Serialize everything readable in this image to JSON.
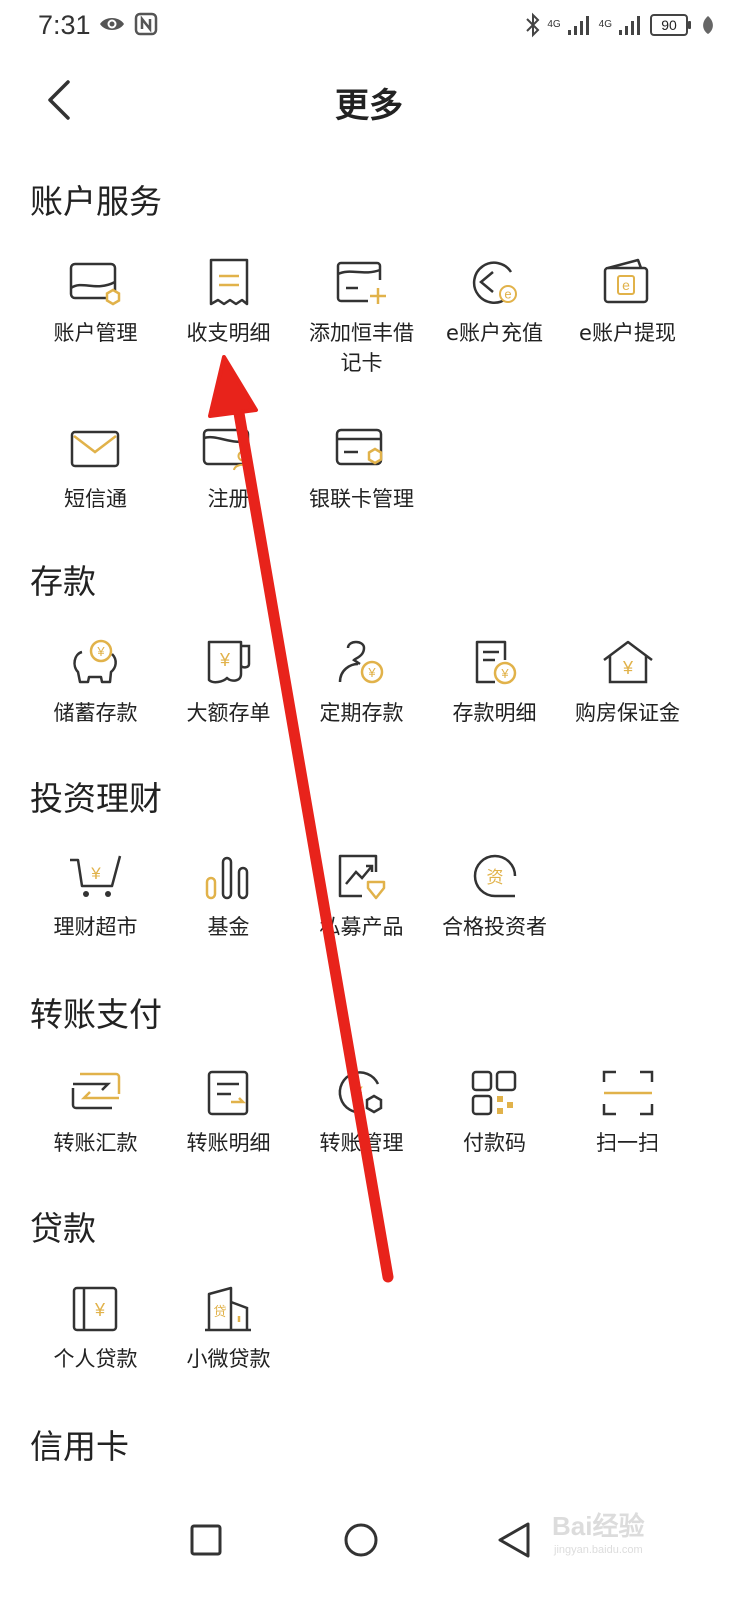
{
  "status_bar": {
    "time": "7:31",
    "network_1": "4G",
    "network_2": "4G",
    "battery": "90"
  },
  "header": {
    "title": "更多"
  },
  "sections": [
    {
      "title": "账户服务",
      "items": [
        {
          "label": "账户管理",
          "icon": "card-shield-icon"
        },
        {
          "label": "收支明细",
          "icon": "receipt-icon"
        },
        {
          "label": "添加恒丰借记卡",
          "icon": "add-card-icon"
        },
        {
          "label": "e账户充值",
          "icon": "e-recharge-icon"
        },
        {
          "label": "e账户提现",
          "icon": "e-wallet-icon"
        },
        {
          "label": "短信通",
          "icon": "envelope-icon"
        },
        {
          "label": "注册",
          "icon": "card-user-icon"
        },
        {
          "label": "银联卡管理",
          "icon": "unionpay-card-icon"
        }
      ]
    },
    {
      "title": "存款",
      "items": [
        {
          "label": "储蓄存款",
          "icon": "piggy-bank-icon"
        },
        {
          "label": "大额存单",
          "icon": "certificate-icon"
        },
        {
          "label": "定期存款",
          "icon": "person-coin-icon"
        },
        {
          "label": "存款明细",
          "icon": "document-coin-icon"
        },
        {
          "label": "购房保证金",
          "icon": "house-coin-icon"
        }
      ]
    },
    {
      "title": "投资理财",
      "items": [
        {
          "label": "理财超市",
          "icon": "shopping-cart-icon"
        },
        {
          "label": "基金",
          "icon": "bar-chart-icon"
        },
        {
          "label": "私募产品",
          "icon": "trend-tag-icon"
        },
        {
          "label": "合格投资者",
          "icon": "investor-icon"
        }
      ]
    },
    {
      "title": "转账支付",
      "items": [
        {
          "label": "转账汇款",
          "icon": "transfer-icon"
        },
        {
          "label": "转账明细",
          "icon": "transfer-detail-icon"
        },
        {
          "label": "转账管理",
          "icon": "transfer-manage-icon"
        },
        {
          "label": "付款码",
          "icon": "qr-code-icon"
        },
        {
          "label": "扫一扫",
          "icon": "scan-icon"
        }
      ]
    },
    {
      "title": "贷款",
      "items": [
        {
          "label": "个人贷款",
          "icon": "loan-book-icon"
        },
        {
          "label": "小微贷款",
          "icon": "loan-building-icon"
        }
      ]
    },
    {
      "title": "信用卡",
      "items": []
    }
  ],
  "watermark": {
    "text": "Bai经验",
    "sub": "jingyan.baidu.com"
  },
  "colors": {
    "accent": "#e1b24a",
    "icon_dark": "#333333",
    "arrow": "#e8231b"
  }
}
